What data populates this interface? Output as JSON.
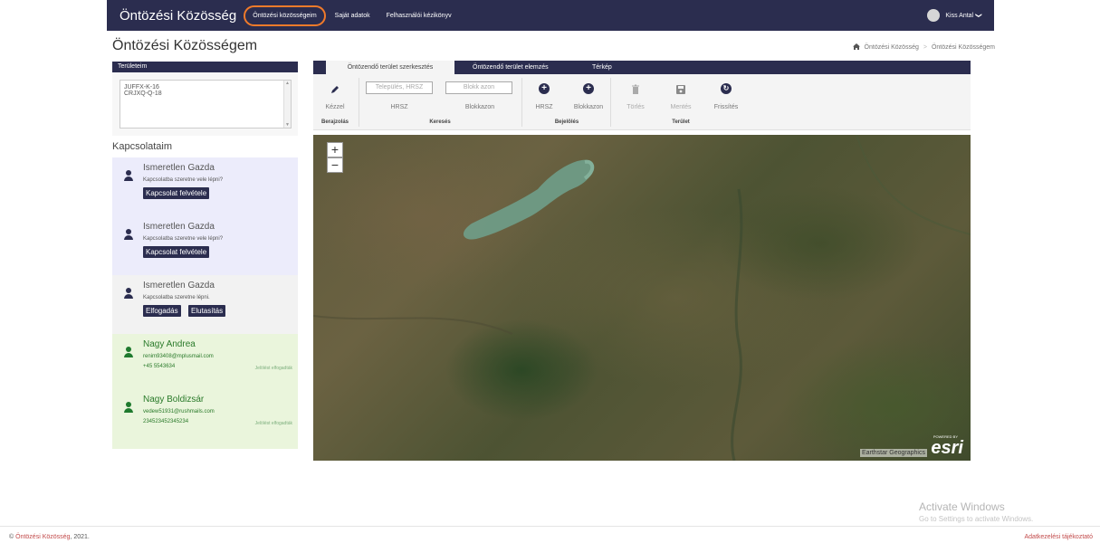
{
  "navbar": {
    "brand": "Öntözési Közösség",
    "links": [
      "Öntözési közösségeim",
      "Saját adatok",
      "Felhasználói kézikönyv"
    ],
    "user": "Kiss Antal",
    "user_chevron": "❯",
    "accent_color": "#f07a2a",
    "bg_color": "#2b2d4f"
  },
  "page": {
    "title": "Öntözési Közösségem",
    "breadcrumb": [
      "Öntözési Közösség",
      ">",
      "Öntözési Közösségem"
    ],
    "breadcrumb_icon": "home-icon"
  },
  "areas": {
    "header": "Területeim",
    "items": [
      "JUFFX-K-16",
      "CRJXQ-Q-18"
    ]
  },
  "contacts": {
    "title": "Kapcsolataim",
    "cards": [
      {
        "name": "Ismeretlen Gazda",
        "text": "Kapcsolatba szeretne vele lépni?",
        "button": "Kapcsolat felvétele"
      },
      {
        "name": "Ismeretlen Gazda",
        "text": "Kapcsolatba szeretne vele lépni?",
        "button": "Kapcsolat felvétele"
      },
      {
        "name": "Ismeretlen Gazda",
        "text": "Kapcsolatba szeretne lépni.",
        "accept": "Elfogadás",
        "reject": "Elutasítás"
      },
      {
        "name": "Nagy Andrea",
        "email": "renim93408@mplusmail.com",
        "phone": "+45 5543634",
        "status": "Jelölést elfogadták"
      },
      {
        "name": "Nagy Boldizsár",
        "email": "vedew51931@rushmails.com",
        "phone": "234523452345234",
        "status": "Jelölést elfogadták"
      }
    ]
  },
  "tabs": [
    "Öntözendő terület szerkesztés",
    "Öntözendő terület elemzés",
    "Térkép"
  ],
  "toolbar": {
    "manual_label": "Kézzel",
    "draw_group": "Berajzolás",
    "settlement_placeholder": "Település, HRSZ",
    "block_placeholder": "Blokk azon",
    "hrsz_label": "HRSZ",
    "block_label": "Blokkazon",
    "search_group": "Keresés",
    "mark_hrsz_label": "HRSZ",
    "mark_block_label": "Blokkazon",
    "mark_group": "Bejelölés",
    "delete_label": "Törlés",
    "save_label": "Mentés",
    "refresh_label": "Frissítés",
    "area_group": "Terület"
  },
  "map": {
    "zoom_in": "+",
    "zoom_out": "−",
    "attribution": "Earthstar Geographics",
    "esri_powered": "POWERED BY",
    "esri_logo": "esri"
  },
  "windows_watermark": {
    "title": "Activate Windows",
    "subtitle": "Go to Settings to activate Windows."
  },
  "footer": {
    "copyright_symbol": "©",
    "copyright_link": "Öntözési Közösség",
    "copyright_year": ", 2021.",
    "privacy": "Adatkezelési tájékoztató"
  }
}
